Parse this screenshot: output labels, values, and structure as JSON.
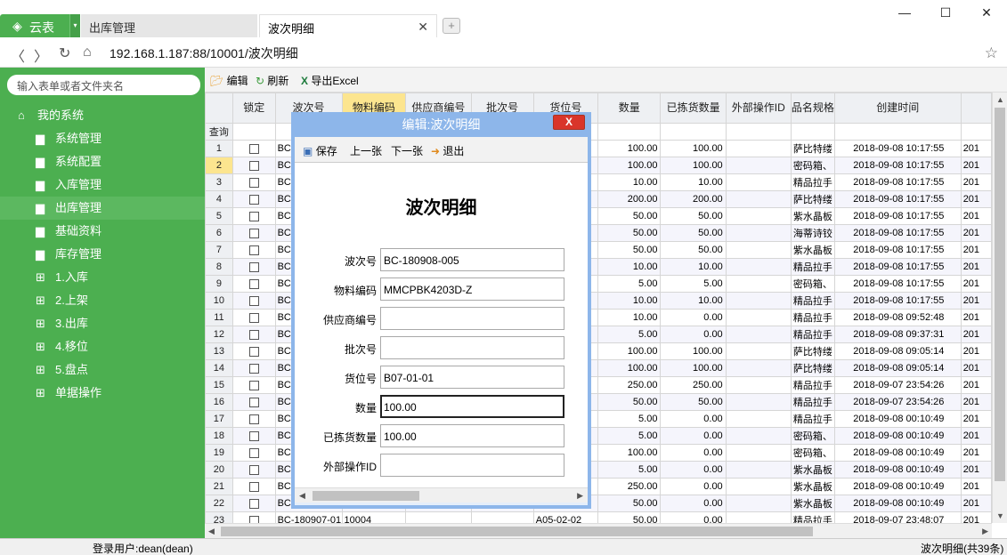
{
  "browser": {
    "app_name": "云表",
    "tabs": [
      {
        "label": "出库管理"
      },
      {
        "label": "波次明细"
      }
    ],
    "url": "192.168.1.187:88/10001/波次明细"
  },
  "sidebar": {
    "search_placeholder": "输入表单或者文件夹名",
    "root": "我的系统",
    "items": [
      {
        "label": "系统管理",
        "icon": "folder-icon"
      },
      {
        "label": "系统配置",
        "icon": "folder-icon"
      },
      {
        "label": "入库管理",
        "icon": "folder-icon"
      },
      {
        "label": "出库管理",
        "icon": "folder-icon",
        "selected": true
      },
      {
        "label": "基础资料",
        "icon": "folder-icon"
      },
      {
        "label": "库存管理",
        "icon": "folder-icon"
      },
      {
        "label": "1.入库",
        "icon": "grid-icon"
      },
      {
        "label": "2.上架",
        "icon": "grid-icon"
      },
      {
        "label": "3.出库",
        "icon": "grid-icon"
      },
      {
        "label": "4.移位",
        "icon": "grid-icon"
      },
      {
        "label": "5.盘点",
        "icon": "grid-icon"
      },
      {
        "label": "单据操作",
        "icon": "grid-icon"
      }
    ]
  },
  "toolbar": {
    "edit": "编辑",
    "refresh": "刷新",
    "export": "导出Excel"
  },
  "grid": {
    "query_label": "查询",
    "columns": [
      "锁定",
      "波次号",
      "物料编码",
      "供应商编号",
      "批次号",
      "货位号",
      "数量",
      "已拣货数量",
      "外部操作ID",
      "品名规格",
      "创建时间",
      ""
    ],
    "rows": [
      {
        "n": "1",
        "wave": "BC",
        "qty": "100.00",
        "picked": "100.00",
        "name": "萨比特缕",
        "time": "2018-09-08 10:17:55",
        "extra": "201"
      },
      {
        "n": "2",
        "wave": "BC",
        "qty": "100.00",
        "picked": "100.00",
        "name": "密码箱、",
        "time": "2018-09-08 10:17:55",
        "extra": "201"
      },
      {
        "n": "3",
        "wave": "BC",
        "qty": "10.00",
        "picked": "10.00",
        "name": "精品拉手",
        "time": "2018-09-08 10:17:55",
        "extra": "201"
      },
      {
        "n": "4",
        "wave": "BC",
        "qty": "200.00",
        "picked": "200.00",
        "name": "萨比特缕",
        "time": "2018-09-08 10:17:55",
        "extra": "201"
      },
      {
        "n": "5",
        "wave": "BC",
        "qty": "50.00",
        "picked": "50.00",
        "name": "紫水晶板",
        "time": "2018-09-08 10:17:55",
        "extra": "201"
      },
      {
        "n": "6",
        "wave": "BC",
        "qty": "50.00",
        "picked": "50.00",
        "name": "海蒂诗铰",
        "time": "2018-09-08 10:17:55",
        "extra": "201"
      },
      {
        "n": "7",
        "wave": "BC",
        "qty": "50.00",
        "picked": "50.00",
        "name": "紫水晶板",
        "time": "2018-09-08 10:17:55",
        "extra": "201"
      },
      {
        "n": "8",
        "wave": "BC",
        "qty": "10.00",
        "picked": "10.00",
        "name": "精品拉手",
        "time": "2018-09-08 10:17:55",
        "extra": "201"
      },
      {
        "n": "9",
        "wave": "BC",
        "qty": "5.00",
        "picked": "5.00",
        "name": "密码箱、",
        "time": "2018-09-08 10:17:55",
        "extra": "201"
      },
      {
        "n": "10",
        "wave": "BC",
        "qty": "10.00",
        "picked": "10.00",
        "name": "精品拉手",
        "time": "2018-09-08 10:17:55",
        "extra": "201"
      },
      {
        "n": "11",
        "wave": "BC",
        "qty": "10.00",
        "picked": "0.00",
        "name": "精品拉手",
        "time": "2018-09-08 09:52:48",
        "extra": "201"
      },
      {
        "n": "12",
        "wave": "BC",
        "qty": "5.00",
        "picked": "0.00",
        "name": "精品拉手",
        "time": "2018-09-08 09:37:31",
        "extra": "201"
      },
      {
        "n": "13",
        "wave": "BC",
        "qty": "100.00",
        "picked": "100.00",
        "name": "萨比特缕",
        "time": "2018-09-08 09:05:14",
        "extra": "201"
      },
      {
        "n": "14",
        "wave": "BC",
        "qty": "100.00",
        "picked": "100.00",
        "name": "萨比特缕",
        "time": "2018-09-08 09:05:14",
        "extra": "201"
      },
      {
        "n": "15",
        "wave": "BC",
        "qty": "250.00",
        "picked": "250.00",
        "name": "精品拉手",
        "time": "2018-09-07 23:54:26",
        "extra": "201"
      },
      {
        "n": "16",
        "wave": "BC",
        "qty": "50.00",
        "picked": "50.00",
        "name": "精品拉手",
        "time": "2018-09-07 23:54:26",
        "extra": "201"
      },
      {
        "n": "17",
        "wave": "BC",
        "qty": "5.00",
        "picked": "0.00",
        "name": "精品拉手",
        "time": "2018-09-08 00:10:49",
        "extra": "201"
      },
      {
        "n": "18",
        "wave": "BC",
        "qty": "5.00",
        "picked": "0.00",
        "name": "密码箱、",
        "time": "2018-09-08 00:10:49",
        "extra": "201"
      },
      {
        "n": "19",
        "wave": "BC",
        "qty": "100.00",
        "picked": "0.00",
        "name": "密码箱、",
        "time": "2018-09-08 00:10:49",
        "extra": "201"
      },
      {
        "n": "20",
        "wave": "BC",
        "qty": "5.00",
        "picked": "0.00",
        "name": "紫水晶板",
        "time": "2018-09-08 00:10:49",
        "extra": "201"
      },
      {
        "n": "21",
        "wave": "BC",
        "qty": "250.00",
        "picked": "0.00",
        "name": "紫水晶板",
        "time": "2018-09-08 00:10:49",
        "extra": "201"
      },
      {
        "n": "22",
        "wave": "BC",
        "qty": "50.00",
        "picked": "0.00",
        "name": "紫水晶板",
        "time": "2018-09-08 00:10:49",
        "extra": "201"
      },
      {
        "n": "23",
        "wave": "BC-180907-01",
        "mat": "10004",
        "loc": "A05-02-02",
        "qty": "50.00",
        "picked": "0.00",
        "name": "精品拉手",
        "time": "2018-09-07 23:48:07",
        "extra": "201"
      }
    ]
  },
  "dialog": {
    "title": "编辑:波次明细",
    "close": "X",
    "tools": {
      "save": "保存",
      "prev": "上一张",
      "next": "下一张",
      "exit": "退出"
    },
    "heading": "波次明细",
    "fields": [
      {
        "label": "波次号",
        "value": "BC-180908-005"
      },
      {
        "label": "物料编码",
        "value": "MMCPBK4203D-Z"
      },
      {
        "label": "供应商编号",
        "value": ""
      },
      {
        "label": "批次号",
        "value": ""
      },
      {
        "label": "货位号",
        "value": "B07-01-01"
      },
      {
        "label": "数量",
        "value": "100.00"
      },
      {
        "label": "已拣货数量",
        "value": "100.00"
      },
      {
        "label": "外部操作ID",
        "value": ""
      }
    ]
  },
  "status": {
    "user": "登录用户:dean(dean)",
    "record": "波次明细(共39条)"
  }
}
